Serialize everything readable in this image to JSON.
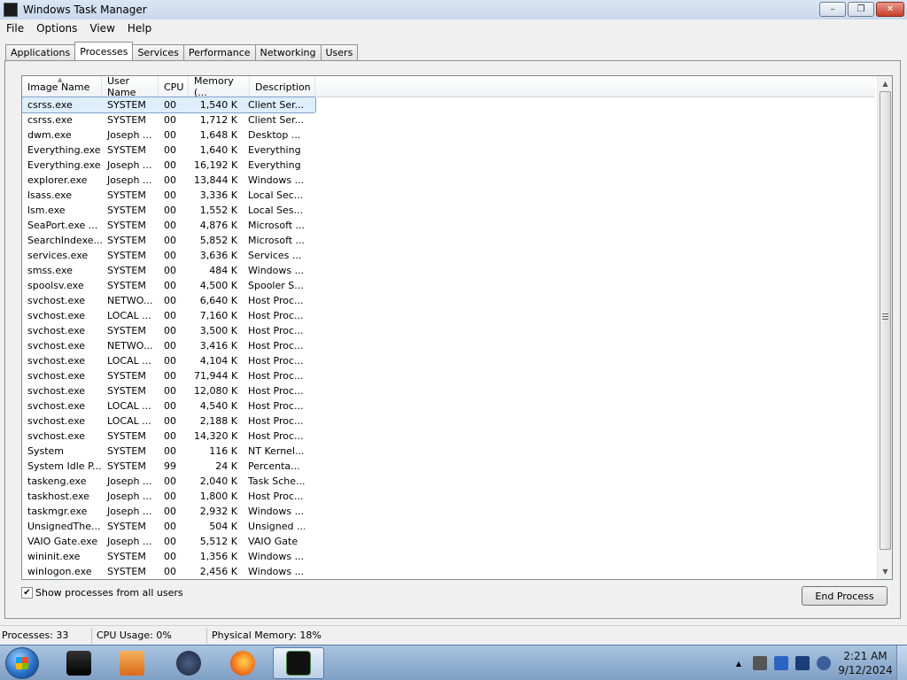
{
  "window": {
    "title": "Windows Task Manager",
    "minimize": "–",
    "maximize": "❐",
    "close": "✕"
  },
  "menu": [
    "File",
    "Options",
    "View",
    "Help"
  ],
  "tabs": [
    "Applications",
    "Processes",
    "Services",
    "Performance",
    "Networking",
    "Users"
  ],
  "active_tab": "Processes",
  "columns": [
    "Image Name",
    "User Name",
    "CPU",
    "Memory (...",
    "Description"
  ],
  "processes": [
    {
      "image": "csrss.exe",
      "user": "SYSTEM",
      "cpu": "00",
      "memory": "1,540 K",
      "description": "Client Ser..."
    },
    {
      "image": "csrss.exe",
      "user": "SYSTEM",
      "cpu": "00",
      "memory": "1,712 K",
      "description": "Client Ser..."
    },
    {
      "image": "dwm.exe",
      "user": "Joseph ...",
      "cpu": "00",
      "memory": "1,648 K",
      "description": "Desktop ..."
    },
    {
      "image": "Everything.exe",
      "user": "SYSTEM",
      "cpu": "00",
      "memory": "1,640 K",
      "description": "Everything"
    },
    {
      "image": "Everything.exe",
      "user": "Joseph ...",
      "cpu": "00",
      "memory": "16,192 K",
      "description": "Everything"
    },
    {
      "image": "explorer.exe",
      "user": "Joseph ...",
      "cpu": "00",
      "memory": "13,844 K",
      "description": "Windows ..."
    },
    {
      "image": "lsass.exe",
      "user": "SYSTEM",
      "cpu": "00",
      "memory": "3,336 K",
      "description": "Local Sec..."
    },
    {
      "image": "lsm.exe",
      "user": "SYSTEM",
      "cpu": "00",
      "memory": "1,552 K",
      "description": "Local Ses..."
    },
    {
      "image": "SeaPort.exe ...",
      "user": "SYSTEM",
      "cpu": "00",
      "memory": "4,876 K",
      "description": "Microsoft ..."
    },
    {
      "image": "SearchIndexe...",
      "user": "SYSTEM",
      "cpu": "00",
      "memory": "5,852 K",
      "description": "Microsoft ..."
    },
    {
      "image": "services.exe",
      "user": "SYSTEM",
      "cpu": "00",
      "memory": "3,636 K",
      "description": "Services ..."
    },
    {
      "image": "smss.exe",
      "user": "SYSTEM",
      "cpu": "00",
      "memory": "484 K",
      "description": "Windows ..."
    },
    {
      "image": "spoolsv.exe",
      "user": "SYSTEM",
      "cpu": "00",
      "memory": "4,500 K",
      "description": "Spooler S..."
    },
    {
      "image": "svchost.exe",
      "user": "NETWO...",
      "cpu": "00",
      "memory": "6,640 K",
      "description": "Host Proc..."
    },
    {
      "image": "svchost.exe",
      "user": "LOCAL ...",
      "cpu": "00",
      "memory": "7,160 K",
      "description": "Host Proc..."
    },
    {
      "image": "svchost.exe",
      "user": "SYSTEM",
      "cpu": "00",
      "memory": "3,500 K",
      "description": "Host Proc..."
    },
    {
      "image": "svchost.exe",
      "user": "NETWO...",
      "cpu": "00",
      "memory": "3,416 K",
      "description": "Host Proc..."
    },
    {
      "image": "svchost.exe",
      "user": "LOCAL ...",
      "cpu": "00",
      "memory": "4,104 K",
      "description": "Host Proc..."
    },
    {
      "image": "svchost.exe",
      "user": "SYSTEM",
      "cpu": "00",
      "memory": "71,944 K",
      "description": "Host Proc..."
    },
    {
      "image": "svchost.exe",
      "user": "SYSTEM",
      "cpu": "00",
      "memory": "12,080 K",
      "description": "Host Proc..."
    },
    {
      "image": "svchost.exe",
      "user": "LOCAL ...",
      "cpu": "00",
      "memory": "4,540 K",
      "description": "Host Proc..."
    },
    {
      "image": "svchost.exe",
      "user": "LOCAL ...",
      "cpu": "00",
      "memory": "2,188 K",
      "description": "Host Proc..."
    },
    {
      "image": "svchost.exe",
      "user": "SYSTEM",
      "cpu": "00",
      "memory": "14,320 K",
      "description": "Host Proc..."
    },
    {
      "image": "System",
      "user": "SYSTEM",
      "cpu": "00",
      "memory": "116 K",
      "description": "NT Kernel..."
    },
    {
      "image": "System Idle P...",
      "user": "SYSTEM",
      "cpu": "99",
      "memory": "24 K",
      "description": "Percenta..."
    },
    {
      "image": "taskeng.exe",
      "user": "Joseph ...",
      "cpu": "00",
      "memory": "2,040 K",
      "description": "Task Sche..."
    },
    {
      "image": "taskhost.exe",
      "user": "Joseph ...",
      "cpu": "00",
      "memory": "1,800 K",
      "description": "Host Proc..."
    },
    {
      "image": "taskmgr.exe",
      "user": "Joseph ...",
      "cpu": "00",
      "memory": "2,932 K",
      "description": "Windows ..."
    },
    {
      "image": "UnsignedThe...",
      "user": "SYSTEM",
      "cpu": "00",
      "memory": "504 K",
      "description": "Unsigned ..."
    },
    {
      "image": "VAIO Gate.exe",
      "user": "Joseph ...",
      "cpu": "00",
      "memory": "5,512 K",
      "description": "VAIO Gate"
    },
    {
      "image": "wininit.exe",
      "user": "SYSTEM",
      "cpu": "00",
      "memory": "1,356 K",
      "description": "Windows ..."
    },
    {
      "image": "winlogon.exe",
      "user": "SYSTEM",
      "cpu": "00",
      "memory": "2,456 K",
      "description": "Windows ..."
    }
  ],
  "selected_row": 0,
  "show_all_label": "Show processes from all users",
  "show_all_checked": true,
  "checkmark": "✔",
  "end_process_label": "End Process",
  "scroll": {
    "up": "▲",
    "down": "▼"
  },
  "status": {
    "processes": "Processes: 33",
    "cpu": "CPU Usage: 0%",
    "memory": "Physical Memory: 18%"
  },
  "taskbar": {
    "items": [
      "start-menu",
      "terminal-app",
      "media-player",
      "steam-app",
      "firefox",
      "task-manager"
    ],
    "tray_arrow": "▲",
    "time": "2:21 AM",
    "date": "9/12/2024"
  },
  "colors": {
    "selection": "#dfeefb",
    "titlebar": "#c8d8ec",
    "taskbar": "#7f9fc4"
  }
}
